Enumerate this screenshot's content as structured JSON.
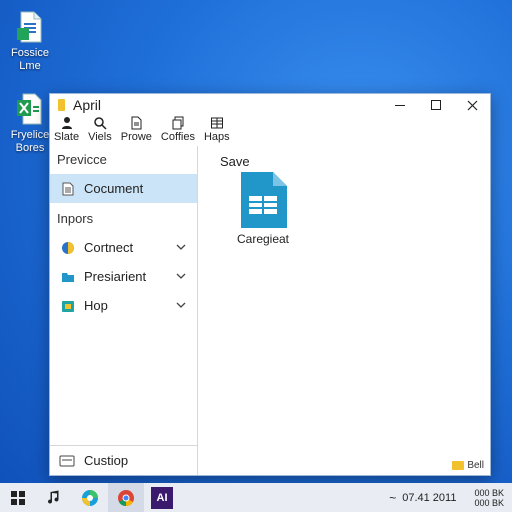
{
  "desktop": {
    "icons": [
      {
        "label_line1": "Fossice",
        "label_line2": "Lme"
      },
      {
        "label_line1": "Fryelice",
        "label_line2": "Bores"
      }
    ]
  },
  "window": {
    "title": "April",
    "ribbon": [
      {
        "label": "Slate",
        "icon": "person-icon"
      },
      {
        "label": "Viels",
        "icon": "search-icon"
      },
      {
        "label": "Prowe",
        "icon": "document-icon"
      },
      {
        "label": "Coffies",
        "icon": "copy-icon"
      },
      {
        "label": "Haps",
        "icon": "grid-icon"
      }
    ],
    "sidebar": {
      "section1": "Previcce",
      "selected_item": "Cocument",
      "section2": "Inpors",
      "items": [
        {
          "label": "Cortnect",
          "icon": "connect-icon"
        },
        {
          "label": "Presiarient",
          "icon": "folder-icon"
        },
        {
          "label": "Hop",
          "icon": "home-icon"
        }
      ],
      "footer": "Custiop"
    },
    "content": {
      "heading": "Save",
      "file_name": "Caregieat",
      "status_text": "Bell"
    }
  },
  "taskbar": {
    "apps": [
      "start-icon",
      "music-icon",
      "edge-icon",
      "chrome-icon",
      "ai-app-icon"
    ],
    "ai_app_label": "AI",
    "tray_chevron": "~",
    "clock": "07.41 2011",
    "tray_line1": "000 BK",
    "tray_line2": "000 BK"
  },
  "colors": {
    "accent": "#1f6fd8",
    "selection": "#cce4f7",
    "folder": "#f2c12e",
    "file_icon": "#2196c9"
  }
}
